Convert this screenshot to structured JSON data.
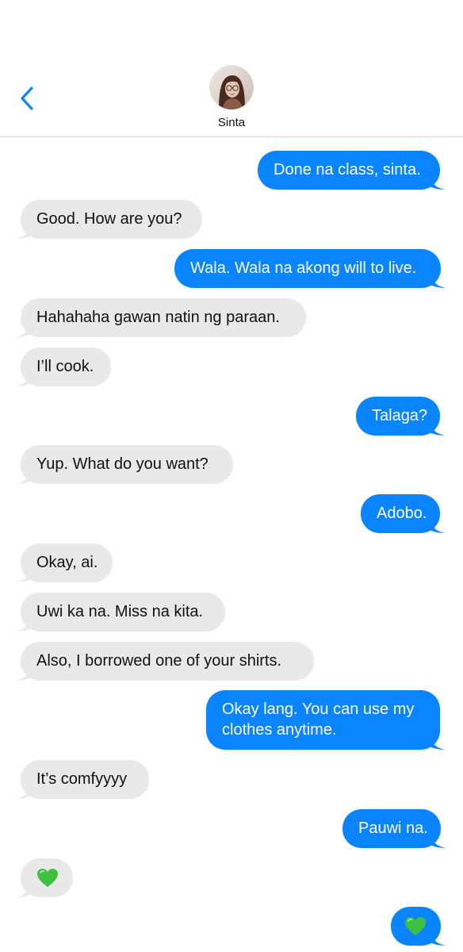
{
  "header": {
    "contact_name": "Sinta",
    "back_icon": "chevron-left-icon",
    "accent_color": "#0a84ff"
  },
  "messages": [
    {
      "from": "me",
      "text": "Done na class, sinta."
    },
    {
      "from": "contact",
      "text": "Good. How are you?"
    },
    {
      "from": "me",
      "text": "Wala. Wala na akong will to live."
    },
    {
      "from": "contact",
      "text": "Hahahaha gawan natin ng paraan."
    },
    {
      "from": "contact",
      "text": "I’ll cook."
    },
    {
      "from": "me",
      "text": "Talaga?"
    },
    {
      "from": "contact",
      "text": "Yup. What do you want?"
    },
    {
      "from": "me",
      "text": "Adobo."
    },
    {
      "from": "contact",
      "text": "Okay, ai."
    },
    {
      "from": "contact",
      "text": "Uwi ka na. Miss na kita."
    },
    {
      "from": "contact",
      "text": "Also, I borrowed one of your shirts."
    },
    {
      "from": "me",
      "text": "Okay lang. You can use my",
      "text_line2": "clothes anytime."
    },
    {
      "from": "contact",
      "text": "It’s comfyyyy"
    },
    {
      "from": "me",
      "text": "Pauwi na."
    },
    {
      "from": "contact",
      "emoji": "green-heart-icon"
    },
    {
      "from": "me",
      "emoji": "green-heart-icon"
    }
  ],
  "colors": {
    "sent_bubble": "#0a84ff",
    "received_bubble": "#e9e9eb",
    "heart": "#3fbf3f"
  }
}
